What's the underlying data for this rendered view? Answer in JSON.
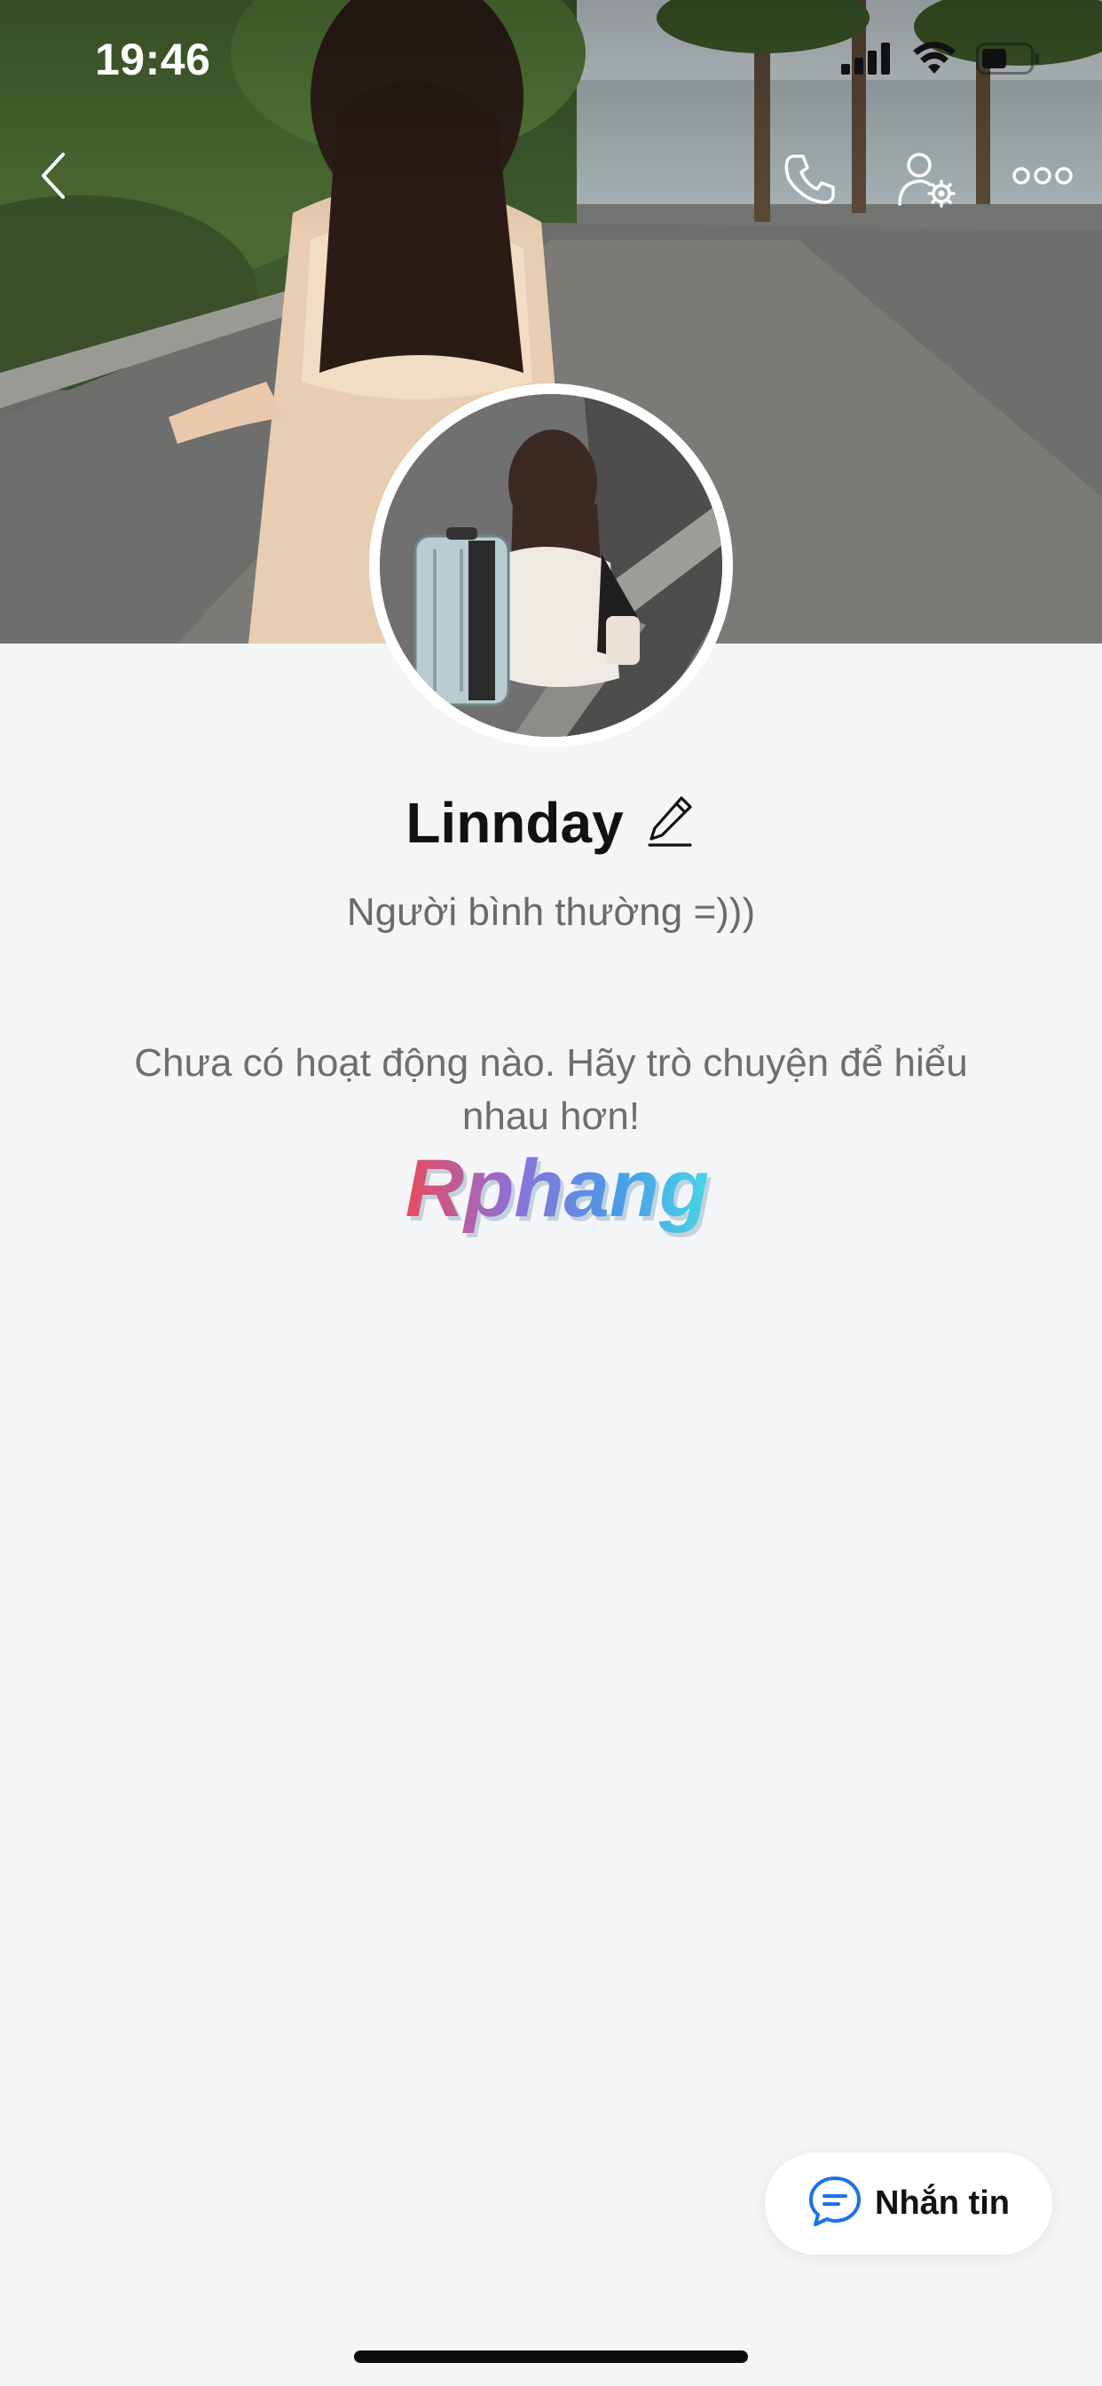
{
  "status_bar": {
    "time": "19:46",
    "icons": [
      "cellular-signal-icon",
      "wifi-icon",
      "battery-icon"
    ]
  },
  "nav": {
    "icons": [
      "back-chevron-icon",
      "phone-call-icon",
      "user-settings-icon",
      "more-dots-icon"
    ]
  },
  "profile": {
    "name": "Linnday",
    "status": "Người bình thường =)))",
    "empty_message": "Chưa có hoạt động nào. Hãy trò chuyện để hiểu nhau hơn!"
  },
  "watermark": {
    "text": "Rphang"
  },
  "actions": {
    "message_label": "Nhắn tin"
  },
  "colors": {
    "background": "#f4f5f7",
    "accent": "#1a73e8",
    "text_primary": "#111111",
    "text_secondary": "#6e6e6e"
  }
}
